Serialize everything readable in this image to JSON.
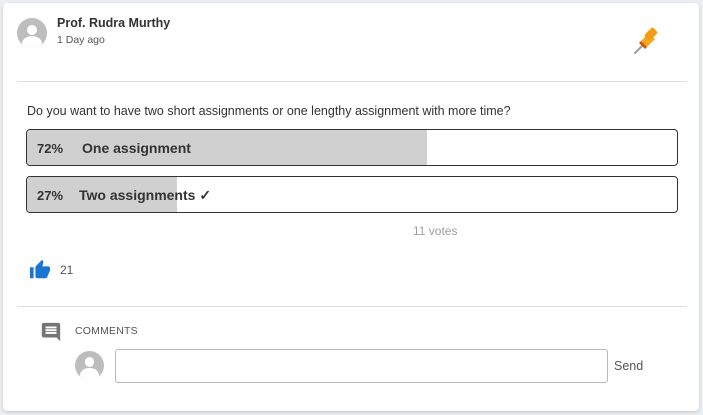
{
  "post": {
    "author": "Prof. Rudra Murthy",
    "time": "1 Day ago",
    "pin_icon": "pushpin-icon"
  },
  "poll": {
    "question": "Do you want to have two short assignments or one lengthy assignment with more time?",
    "options": [
      {
        "percent_label": "72%",
        "label": "One assignment",
        "fraction": 0.72,
        "selected": false
      },
      {
        "percent_label": "27%",
        "label": "Two assignments ✓",
        "fraction": 0.27,
        "selected": true
      }
    ],
    "votes": "11 votes"
  },
  "reactions": {
    "like_icon": "thumbs-up-icon",
    "like_count": "21"
  },
  "comments": {
    "icon": "comment-icon",
    "label": "COMMENTS",
    "input_value": "",
    "send_label": "Send"
  },
  "colors": {
    "accent_blue": "#1976d2",
    "bar_fill": "#d0d0d0",
    "pin_orange": "#f5a623"
  }
}
